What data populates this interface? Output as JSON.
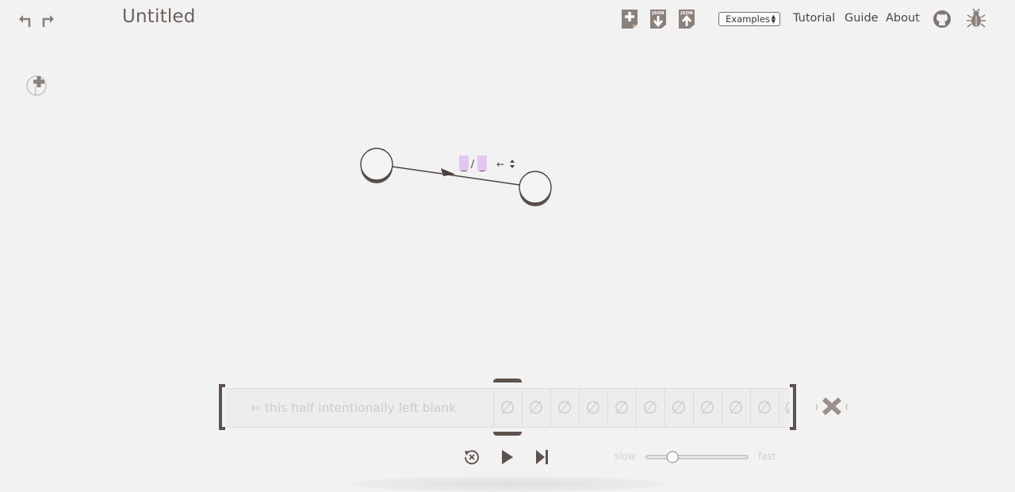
{
  "header": {
    "title": "Untitled",
    "examples_label": "Examples",
    "nav": {
      "tutorial": "Tutorial",
      "guide": "Guide",
      "about": "About"
    },
    "json_label": "JSON"
  },
  "diagram": {
    "transition_label": {
      "read": "_",
      "sep": "/",
      "write": "_",
      "move": "←"
    }
  },
  "tape": {
    "blank_note": "⇐ this half intentionally left blank",
    "blank_symbol": "∅"
  },
  "controls": {
    "slow_label": "slow",
    "fast_label": "fast",
    "speed": 0.23
  },
  "colors": {
    "background": "#f2f2f2",
    "ink": "#5d524d",
    "accent_highlight": "#e2c8ef"
  }
}
